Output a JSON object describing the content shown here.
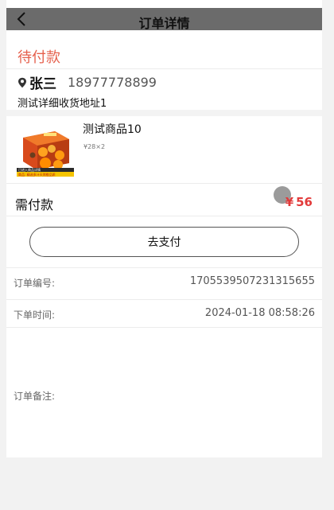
{
  "header": {
    "title": "订单详情"
  },
  "order": {
    "status": "待付款"
  },
  "address": {
    "name": "张三",
    "phone": "18977778899",
    "detail": "测试详细收货地址1"
  },
  "goods": {
    "name": "测试商品10",
    "spec": "¥28×2",
    "image_caption_line1": "已进入商品详情",
    "image_caption_line2": "商品: 精选多汁天然橙品质"
  },
  "payment": {
    "label": "需付款",
    "currency": "¥",
    "amount": "56",
    "button_label": "去支付"
  },
  "info": {
    "order_no_label": "订单编号:",
    "order_no_value": "1705539507231315655",
    "order_time_label": "下单时间:",
    "order_time_value": "2024-01-18 08:58:26",
    "remark_label": "订单备注:"
  },
  "colors": {
    "status": "#e5604d",
    "amount": "#e23a3a",
    "navbar": "#6b6b6b"
  }
}
